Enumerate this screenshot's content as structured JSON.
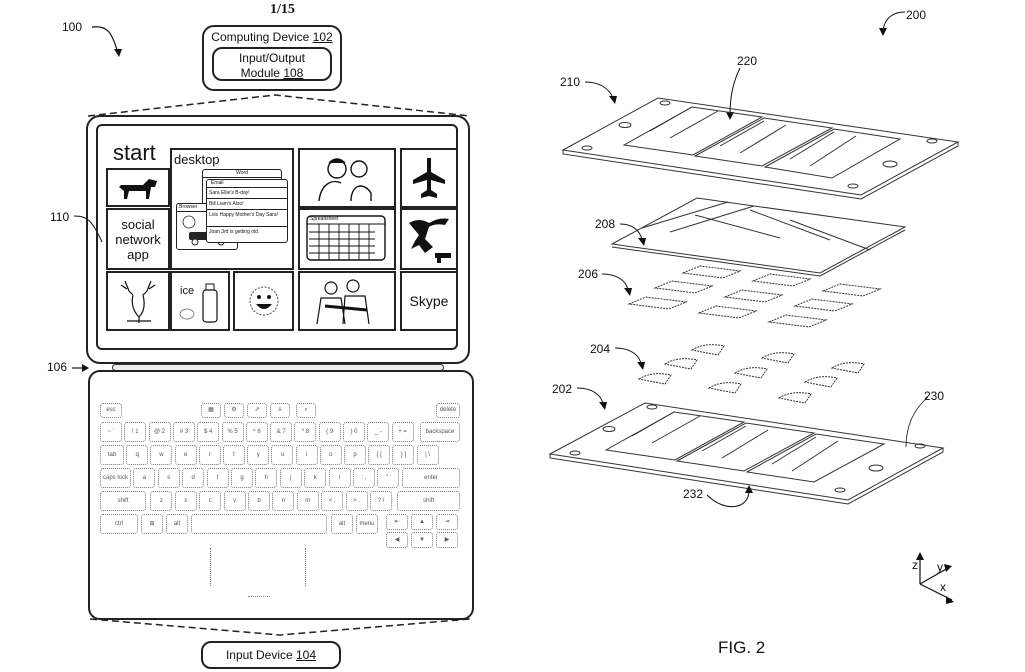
{
  "sheet": "1/15",
  "fig1": {
    "ref_100": "100",
    "ref_106": "106",
    "ref_110": "110",
    "computing_device": {
      "label": "Computing Device",
      "num": "102"
    },
    "io_module": {
      "label_line1": "Input/Output",
      "label_line2": "Module",
      "num": "108"
    },
    "input_device": {
      "label": "Input Device",
      "num": "104"
    },
    "screen": {
      "start": "start",
      "desktop": "desktop",
      "social_app": "social network app",
      "ice": "ice",
      "skype": "Skype",
      "windows": {
        "word": "Word",
        "email": "Email",
        "browser": "Browser",
        "spreadsheet": "Spreadsheet",
        "email_rows": [
          {
            "from": "Sara",
            "msg": "Ellie's B-day!"
          },
          {
            "from": "Bill",
            "msg": "Liam's Also!"
          },
          {
            "from": "Lois",
            "msg": "Happy Mother's Day Sara!"
          },
          {
            "from": "Joan",
            "msg": "3rd is getting old."
          }
        ]
      },
      "tile_icons": [
        "dog-icon",
        "airplane-icon",
        "family-icon",
        "monkey-icon",
        "deer-icon",
        "shaker-icon",
        "sun-icon",
        "group-icon"
      ]
    },
    "keyboard": {
      "fn_row": [
        "esc",
        "▦",
        "⚙",
        "⇗",
        "⅄",
        "⌕",
        "delete"
      ],
      "num_row": [
        "~ `",
        "! 1",
        "@ 2",
        "# 3",
        "$ 4",
        "% 5",
        "^ 6",
        "& 7",
        "* 8",
        "( 9",
        ") 0",
        "_ -",
        "+ =",
        "backspace"
      ],
      "q_row": [
        "tab",
        "q",
        "w",
        "e",
        "r",
        "t",
        "y",
        "u",
        "i",
        "o",
        "p",
        "{ [",
        "} ]",
        "| \\"
      ],
      "a_row": [
        "caps lock",
        "a",
        "s",
        "d",
        "f",
        "g",
        "h",
        "j",
        "k",
        "l",
        ": ;",
        "\" '",
        "enter"
      ],
      "z_row": [
        "shift",
        "z",
        "x",
        "c",
        "v",
        "b",
        "n",
        "m",
        "< ,",
        "> .",
        "? /",
        "shift"
      ],
      "bottom_row": [
        "ctrl",
        "⊞",
        "alt",
        "",
        "alt",
        "menu"
      ],
      "nav_top": [
        "⇤",
        "▲",
        "⇥"
      ],
      "nav_bottom": [
        "◀",
        "▼",
        "▶"
      ]
    }
  },
  "fig2": {
    "ref_200": "200",
    "ref_210": "210",
    "ref_220": "220",
    "ref_208": "208",
    "ref_206": "206",
    "ref_204": "204",
    "ref_202": "202",
    "ref_230": "230",
    "ref_232": "232",
    "axes": {
      "x": "x",
      "y": "y",
      "z": "z"
    },
    "caption": "FIG. 2"
  }
}
